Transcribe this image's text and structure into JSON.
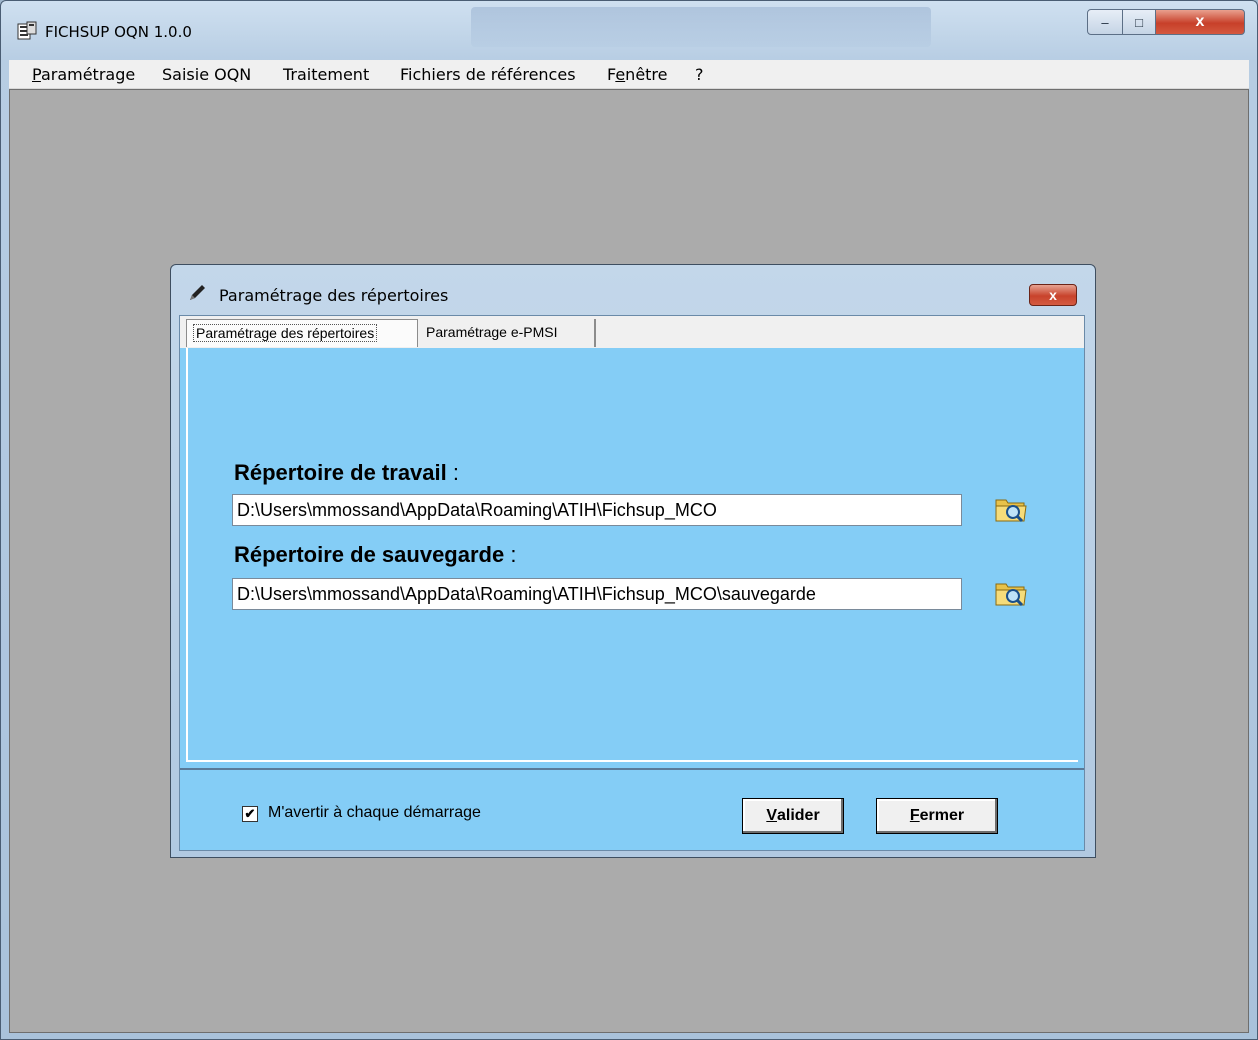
{
  "window": {
    "title": "FICHSUP OQN 1.0.0",
    "controls": {
      "minimize": "–",
      "maximize": "□",
      "close": "x"
    }
  },
  "menu": {
    "items": [
      {
        "key": "P",
        "rest": "aramétrage"
      },
      {
        "key": "",
        "rest": "Saisie OQN"
      },
      {
        "key": "",
        "rest": "Traitement"
      },
      {
        "key": "",
        "rest": "Fichiers de références"
      },
      {
        "key": "Fe",
        "rest": "nêtre",
        "pre": ""
      },
      {
        "key": "",
        "rest": "?"
      }
    ]
  },
  "dialog": {
    "title": "Paramétrage des répertoires",
    "close": "x",
    "tabs": [
      "Paramétrage des répertoires",
      "Paramétrage e-PMSI"
    ],
    "work_label": "Répertoire de travail",
    "save_label": "Répertoire de sauvegarde",
    "colon": " :",
    "work_path": "D:\\Users\\mmossand\\AppData\\Roaming\\ATIH\\Fichsup_MCO",
    "save_path": "D:\\Users\\mmossand\\AppData\\Roaming\\ATIH\\Fichsup_MCO\\sauvegarde",
    "checkbox_label": "M'avertir à chaque démarrage",
    "checkbox_checked": true,
    "checkbox_mark": "✔",
    "validate_key": "V",
    "validate_rest": "alider",
    "close_key": "F",
    "close_rest": "ermer"
  },
  "colors": {
    "dialog_bg": "#84cdf6",
    "client_bg": "#ababab",
    "menubar_bg": "#f0f0f0"
  }
}
